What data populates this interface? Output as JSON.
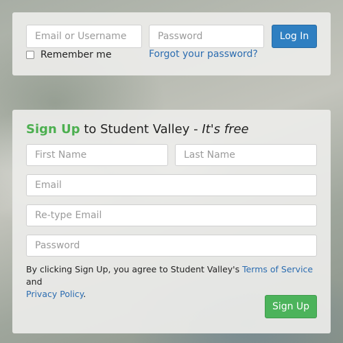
{
  "login": {
    "username_placeholder": "Email or Username",
    "password_placeholder": "Password",
    "login_button": "Log In",
    "remember_label": "Remember me",
    "forgot_link": "Forgot your password?"
  },
  "signup": {
    "title_accent": "Sign Up",
    "title_middle": " to Student Valley - ",
    "title_free": "It's free",
    "first_name_placeholder": "First Name",
    "last_name_placeholder": "Last Name",
    "email_placeholder": "Email",
    "retype_email_placeholder": "Re-type Email",
    "password_placeholder": "Password",
    "terms_prefix": "By clicking Sign Up, you agree to Student Valley's ",
    "terms_link": "Terms of Service",
    "terms_and": " and",
    "privacy_link": "Privacy Policy",
    "terms_suffix": ".",
    "signup_button": "Sign Up"
  },
  "colors": {
    "login_button": "#2f7fc1",
    "signup_button": "#4cb35b",
    "accent_green": "#4caf50",
    "link_blue": "#2b6cb0"
  }
}
